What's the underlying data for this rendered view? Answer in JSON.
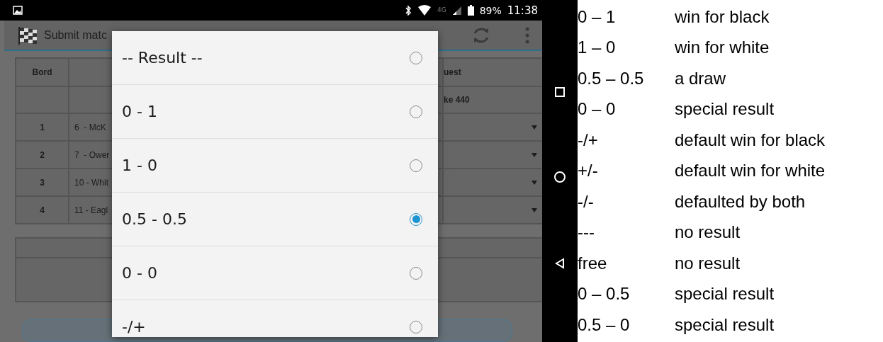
{
  "status_bar": {
    "network": "4G",
    "battery": "89%",
    "time": "11:38"
  },
  "app_bar": {
    "title": "Submit matc"
  },
  "table": {
    "columns": [
      "Bord",
      "uest"
    ],
    "team_row": {
      "guest": "ke 440"
    },
    "rows": [
      {
        "board": "1",
        "player": "6  - McK"
      },
      {
        "board": "2",
        "player": "7  - Ower"
      },
      {
        "board": "3",
        "player": "10 - Whit"
      },
      {
        "board": "4",
        "player": "11 - Eagl"
      }
    ]
  },
  "dialog": {
    "options": [
      {
        "label": "-- Result --",
        "selected": false
      },
      {
        "label": "0 - 1",
        "selected": false
      },
      {
        "label": "1 - 0",
        "selected": false
      },
      {
        "label": "0.5 - 0.5",
        "selected": true
      },
      {
        "label": "0 - 0",
        "selected": false
      },
      {
        "label": "-/+",
        "selected": false
      }
    ]
  },
  "legend": [
    {
      "code": "0 – 1",
      "meaning": "win for black"
    },
    {
      "code": "1 – 0",
      "meaning": "win for white"
    },
    {
      "code": "0.5 – 0.5",
      "meaning": "a draw"
    },
    {
      "code": "0 – 0",
      "meaning": "special result"
    },
    {
      "code": "-/+",
      "meaning": "default win for black"
    },
    {
      "code": "+/-",
      "meaning": "default win for white"
    },
    {
      "code": "-/-",
      "meaning": "defaulted by both"
    },
    {
      "code": "---",
      "meaning": "no result"
    },
    {
      "code": "free",
      "meaning": "no result"
    },
    {
      "code": "0 – 0.5",
      "meaning": "special result"
    },
    {
      "code": "0.5 – 0",
      "meaning": "special result"
    }
  ]
}
